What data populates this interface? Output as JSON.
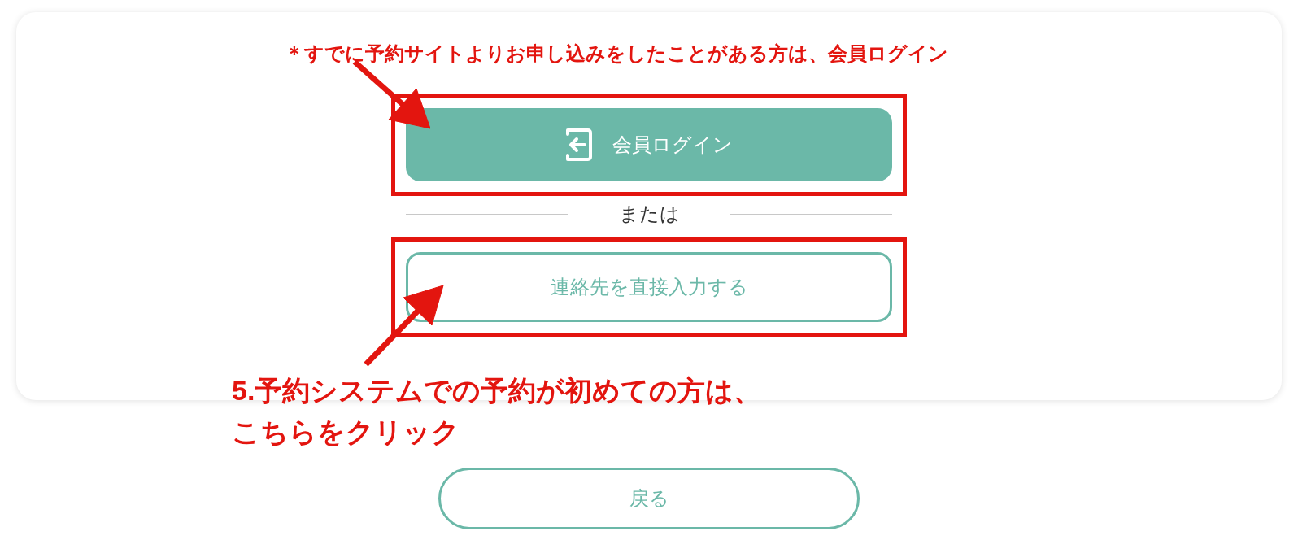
{
  "top_note": "＊すでに予約サイトよりお申し込みをしたことがある方は、会員ログイン",
  "login_button": {
    "label": "会員ログイン"
  },
  "divider_text": "または",
  "direct_button": {
    "label": "連絡先を直接入力する"
  },
  "step_note": {
    "lines": [
      "5.予約システムでの予約が初めての方は、",
      "こちらをクリック"
    ]
  },
  "back_button": {
    "label": "戻る"
  }
}
